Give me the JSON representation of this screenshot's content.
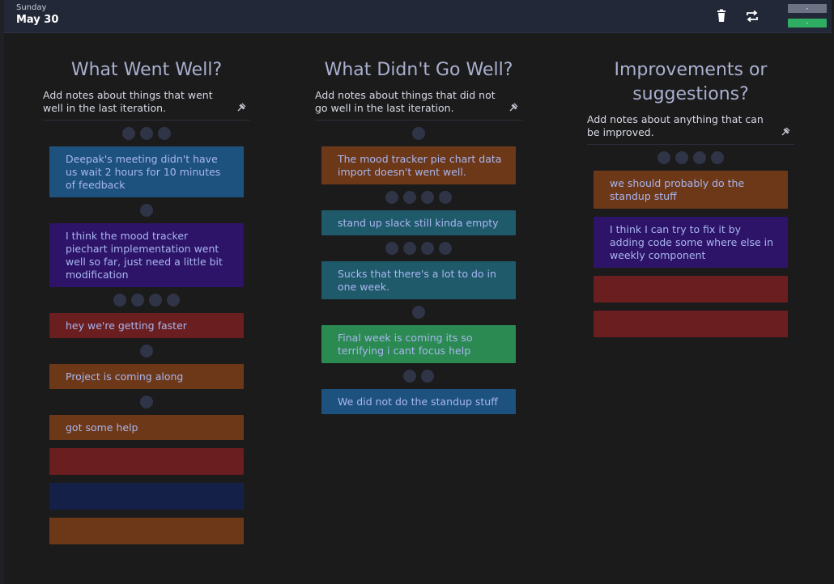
{
  "header": {
    "day": "Sunday",
    "date": "May 30",
    "mini_top_label": "-",
    "mini_bottom_label": "-"
  },
  "columns": [
    {
      "title": "What Went Well?",
      "description": "Add notes about things that went well in the last iteration.",
      "cards": [
        {
          "text": "Deepak's meeting didn't have us wait 2 hours for 10 minutes of feedback",
          "color": "#1e527e"
        },
        {
          "text": "I think the mood tracker piechart implementation went well so far, just need a little bit modification",
          "color": "#2d1468"
        },
        {
          "text": "hey we're getting faster",
          "color": "#6a1e1f"
        },
        {
          "text": "Project is coming along",
          "color": "#6d3818"
        },
        {
          "text": "got some help",
          "color": "#6d3818"
        },
        {
          "text": "",
          "color": "#6a1e1f"
        },
        {
          "text": "",
          "color": "#152049"
        },
        {
          "text": "",
          "color": "#6d3818"
        }
      ]
    },
    {
      "title": "What Didn't Go Well?",
      "description": "Add notes about things that did not go well in the last iteration.",
      "cards": [
        {
          "text": "The mood tracker pie chart data import doesn't went well.",
          "color": "#6d3818"
        },
        {
          "text": "stand up slack still kinda empty",
          "color": "#1f5a6b"
        },
        {
          "text": "Sucks that there's a lot to do in one week.",
          "color": "#1f5a6b"
        },
        {
          "text": "Final week is coming its so terrifying i cant focus help",
          "color": "#2b8a51"
        },
        {
          "text": "We did not do the standup stuff",
          "color": "#1e527e"
        }
      ]
    },
    {
      "title": "Improvements or suggestions?",
      "description": "Add notes about anything that can be improved.",
      "cards": [
        {
          "text": "we should probably do the standup stuff",
          "color": "#6d3818"
        },
        {
          "text": "I think I can try to fix it by adding code some where else in weekly component",
          "color": "#2d1468"
        },
        {
          "text": "",
          "color": "#6a1e1f"
        },
        {
          "text": "",
          "color": "#6a1e1f"
        }
      ]
    }
  ],
  "icons": {
    "trash": "trash-icon",
    "repeat": "repeat-icon",
    "pin": "pin-icon"
  }
}
